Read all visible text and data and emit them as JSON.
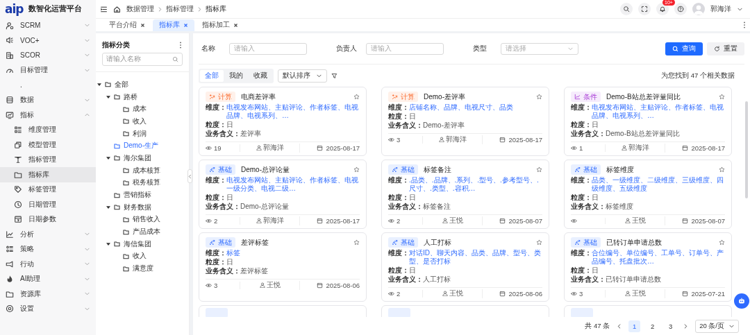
{
  "sidebar": {
    "logo": "aip",
    "title": "数智化运营平台",
    "items": [
      {
        "label": "SCRM",
        "expanded": false,
        "selected": false
      },
      {
        "label": "VOC+",
        "expanded": false,
        "selected": false
      },
      {
        "label": "SCOR",
        "expanded": false,
        "selected": false
      },
      {
        "label": "目标管理",
        "expanded": false,
        "selected": false
      },
      {
        "label": ".",
        "selected": false
      },
      {
        "label": "数据",
        "expanded": false,
        "selected": false
      },
      {
        "label": "指标",
        "expanded": true,
        "selected": false,
        "children": [
          {
            "label": "维度管理",
            "selected": false
          },
          {
            "label": "模型管理",
            "selected": false
          },
          {
            "label": "指标管理",
            "selected": false
          },
          {
            "label": "指标库",
            "selected": true
          },
          {
            "label": "标签管理",
            "selected": false
          },
          {
            "label": "日期管理",
            "selected": false
          },
          {
            "label": "日期参数",
            "selected": false
          }
        ]
      },
      {
        "label": "分析",
        "expanded": false,
        "selected": false
      },
      {
        "label": "策略",
        "expanded": false,
        "selected": false
      },
      {
        "label": "行动",
        "expanded": false,
        "selected": false
      },
      {
        "label": "AI助理",
        "expanded": false,
        "selected": false
      },
      {
        "label": "资源库",
        "expanded": false,
        "selected": false
      },
      {
        "label": "设置",
        "expanded": false,
        "selected": false
      }
    ]
  },
  "header": {
    "breadcrumb": [
      "数据管理",
      "指标管理",
      "指标库"
    ],
    "notification_badge": "10+",
    "user": "郭海洋"
  },
  "tabs": [
    {
      "label": "平台介绍",
      "selected": false
    },
    {
      "label": "指标库",
      "selected": true
    },
    {
      "label": "指标加工",
      "selected": false
    }
  ],
  "tree": {
    "title": "指标分类",
    "search_placeholder": "请输入名称",
    "items": [
      {
        "label": "全部",
        "expanded": true,
        "selected": false,
        "children": [
          {
            "label": "路桥",
            "expanded": true,
            "selected": false,
            "children": [
              {
                "label": "成本",
                "selected": false
              },
              {
                "label": "收入",
                "selected": false
              },
              {
                "label": "利润",
                "selected": false
              }
            ]
          },
          {
            "label": "Demo-生产",
            "selected": true
          },
          {
            "label": "海尔集团",
            "expanded": true,
            "selected": false,
            "children": [
              {
                "label": "成本核算",
                "selected": false
              },
              {
                "label": "税务核算",
                "selected": false
              }
            ]
          },
          {
            "label": "营销指标",
            "selected": false
          },
          {
            "label": "财务数据",
            "expanded": true,
            "selected": false,
            "children": [
              {
                "label": "销售收入",
                "selected": false
              },
              {
                "label": "产品成本",
                "selected": false
              }
            ]
          },
          {
            "label": "海信集团",
            "expanded": true,
            "selected": false,
            "children": [
              {
                "label": "收入",
                "selected": false
              },
              {
                "label": "满意度",
                "selected": false
              }
            ]
          }
        ]
      }
    ]
  },
  "filters": [
    {
      "label": "名称",
      "placeholder": "请输入",
      "kind": "input"
    },
    {
      "label": "负责人",
      "placeholder": "请输入",
      "kind": "input"
    },
    {
      "label": "类型",
      "placeholder": "请选择",
      "kind": "select"
    }
  ],
  "buttons": [
    {
      "label": "查询",
      "kind": "primary"
    },
    {
      "label": "重置",
      "kind": "default"
    }
  ],
  "segments": [
    {
      "label": "全部",
      "selected": true
    },
    {
      "label": "我的",
      "selected": false
    },
    {
      "label": "收藏",
      "selected": false
    }
  ],
  "sort": "默认排序",
  "result_text": "为您找到 47 个相关数据",
  "cards": [
    {
      "kind": "compute",
      "tag": "计算",
      "title": "电商差评率",
      "starred": false,
      "fields": [
        {
          "label": "维度：",
          "value": "电视发布网站、主贴评论、作者标签、电视品牌、电视系列、…",
          "kind": "link"
        },
        {
          "label": "粒度：",
          "value": "日",
          "kind": "plain"
        },
        {
          "label": "业务含义：",
          "value": "差评率",
          "kind": "plain"
        }
      ],
      "views": "19",
      "owner": "郭海洋",
      "date": "2025-08-17"
    },
    {
      "kind": "compute",
      "tag": "计算",
      "title": "Demo-差评率",
      "starred": false,
      "fields": [
        {
          "label": "维度：",
          "value": "店铺名称、品牌、电视尺寸、品类",
          "kind": "link"
        },
        {
          "label": "粒度：",
          "value": "日",
          "kind": "plain"
        },
        {
          "label": "业务含义：",
          "value": "Demo-差评率",
          "kind": "plain"
        }
      ],
      "views": "3",
      "owner": "郭海洋",
      "date": "2025-08-17"
    },
    {
      "kind": "condition",
      "tag": "条件",
      "title": "Demo-B站总差评量同比",
      "starred": false,
      "fields": [
        {
          "label": "维度：",
          "value": "电视发布网站、主贴评论、作者标签、电视品牌、电视系列、…",
          "kind": "link"
        },
        {
          "label": "粒度：",
          "value": "日",
          "kind": "plain"
        },
        {
          "label": "业务含义：",
          "value": "Demo-B站总差评量同比",
          "kind": "plain"
        }
      ],
      "views": "1",
      "owner": "郭海洋",
      "date": "2025-08-17"
    },
    {
      "kind": "basic",
      "tag": "基础",
      "title": "Demo-总评论量",
      "starred": false,
      "fields": [
        {
          "label": "维度：",
          "value": "电视发布网站、主贴评论、作者标签、电视一级分类、电视二级…",
          "kind": "link"
        },
        {
          "label": "粒度：",
          "value": "日",
          "kind": "plain"
        },
        {
          "label": "业务含义：",
          "value": "Demo-总评论量",
          "kind": "plain"
        }
      ],
      "views": "2",
      "owner": "郭海洋",
      "date": "2025-08-17"
    },
    {
      "kind": "basic",
      "tag": "基础",
      "title": "标签备注",
      "starred": false,
      "fields": [
        {
          "label": "维度：",
          "value": ".品类、.品牌、.系列、.型号、.参考型号、.尺寸、.类型、.容积…",
          "kind": "link"
        },
        {
          "label": "粒度：",
          "value": "日",
          "kind": "plain"
        },
        {
          "label": "业务含义：",
          "value": "标签备注",
          "kind": "plain"
        }
      ],
      "views": "2",
      "owner": "王悦",
      "date": "2025-08-07"
    },
    {
      "kind": "basic",
      "tag": "基础",
      "title": "标签维度",
      "starred": false,
      "fields": [
        {
          "label": "维度：",
          "value": "品类、一级维度、二级维度、三级维度、四级维度、五级维度",
          "kind": "link"
        },
        {
          "label": "粒度：",
          "value": "日",
          "kind": "plain"
        },
        {
          "label": "业务含义：",
          "value": "标签维度",
          "kind": "plain"
        }
      ],
      "owner": "王悦",
      "date": "2025-08-07"
    },
    {
      "kind": "basic",
      "tag": "基础",
      "title": "差评标签",
      "starred": false,
      "fields": [
        {
          "label": "维度：",
          "value": "标签",
          "kind": "link"
        },
        {
          "label": "粒度：",
          "value": "日",
          "kind": "plain"
        },
        {
          "label": "业务含义：",
          "value": "差评标签",
          "kind": "plain"
        }
      ],
      "views": "3",
      "owner": "王悦",
      "date": "2025-08-06"
    },
    {
      "kind": "basic",
      "tag": "基础",
      "title": "人工打标",
      "starred": false,
      "fields": [
        {
          "label": "维度：",
          "value": "对话ID、聊天内容、品类、品牌、型号、类型、是否打标",
          "kind": "link"
        },
        {
          "label": "粒度：",
          "value": "日",
          "kind": "plain"
        },
        {
          "label": "业务含义：",
          "value": "人工打标",
          "kind": "plain"
        }
      ],
      "views": "2",
      "owner": "王悦",
      "date": "2025-08-06"
    },
    {
      "kind": "basic",
      "tag": "基础",
      "title": "已转订单申请总数",
      "starred": false,
      "fields": [
        {
          "label": "维度：",
          "value": "合位编号、单位编号、工单号、订单号、产品编号、托盘批次…",
          "kind": "link"
        },
        {
          "label": "粒度：",
          "value": "日",
          "kind": "plain"
        },
        {
          "label": "业务含义：",
          "value": "已转订单申请总数",
          "kind": "plain"
        }
      ],
      "views": "3",
      "owner": "王悦",
      "date": "2025-07-21"
    }
  ],
  "more_cards": [
    {
      "kind": "basic"
    },
    {
      "kind": "basic"
    },
    {
      "kind": "basic"
    }
  ],
  "pager": {
    "total": "共 47 条",
    "pages": [
      {
        "label": "1",
        "selected": true
      },
      {
        "label": "2",
        "selected": false
      },
      {
        "label": "3",
        "selected": false
      }
    ],
    "page_size": "20 条/页"
  }
}
